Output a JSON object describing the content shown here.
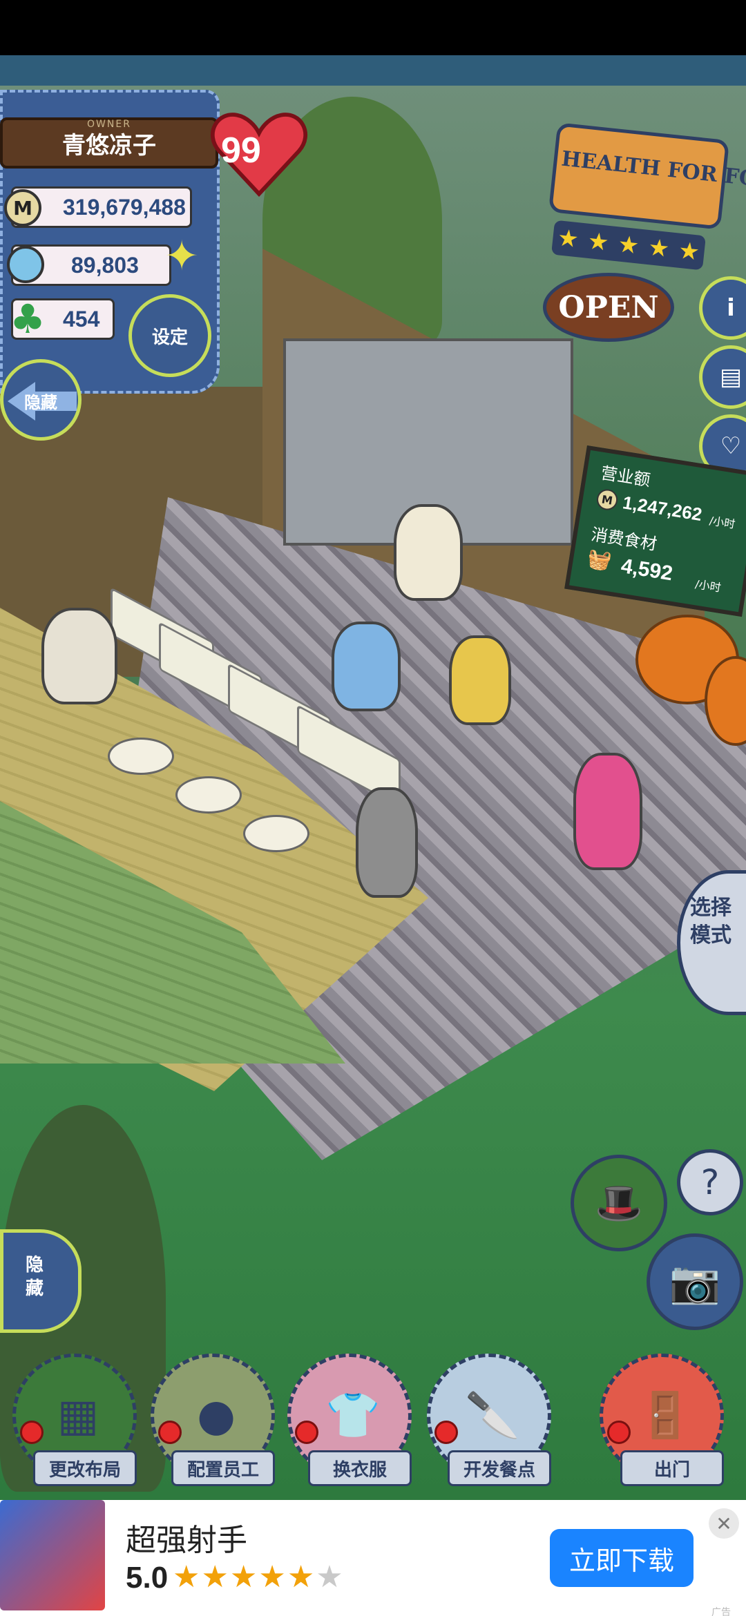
{
  "owner": {
    "caption": "OWNER",
    "name": "青悠凉子",
    "level": "99",
    "coins": "319,679,488",
    "food": "89,803",
    "clover": "454",
    "coin_glyph": "M"
  },
  "buttons": {
    "settings": "设定",
    "hide_top": "隐藏",
    "hide_bottom": "隐藏",
    "mode": "选择模式"
  },
  "shop": {
    "sign_text": "HEALTH FOR FOOD",
    "rating_stars": 5,
    "open_text": "OPEN"
  },
  "side_icons": {
    "info": "i",
    "help": "?"
  },
  "board": {
    "revenue_label": "营业额",
    "revenue_value": "1,247,262",
    "revenue_unit": "/小时",
    "consume_label": "消费食材",
    "consume_value": "4,592",
    "consume_unit": "/小时",
    "coin_glyph": "M"
  },
  "bottom_menu": [
    {
      "label": "更改布局",
      "icon": "table-icon"
    },
    {
      "label": "配置员工",
      "icon": "bear-icon"
    },
    {
      "label": "换衣服",
      "icon": "shirt-icon"
    },
    {
      "label": "开发餐点",
      "icon": "knife-icon"
    },
    {
      "label": "出门",
      "icon": "door-icon"
    }
  ],
  "ad": {
    "title": "超强射手",
    "score": "5.0",
    "stars_filled": 5,
    "stars_total": 6,
    "download_label": "立即下载",
    "close": "✕",
    "tag": "广告"
  },
  "colors": {
    "panel_blue": "#3a5b8f",
    "accent_lime": "#c6dd5a",
    "ad_blue": "#1a84ff",
    "sign_orange": "#e29a44"
  }
}
